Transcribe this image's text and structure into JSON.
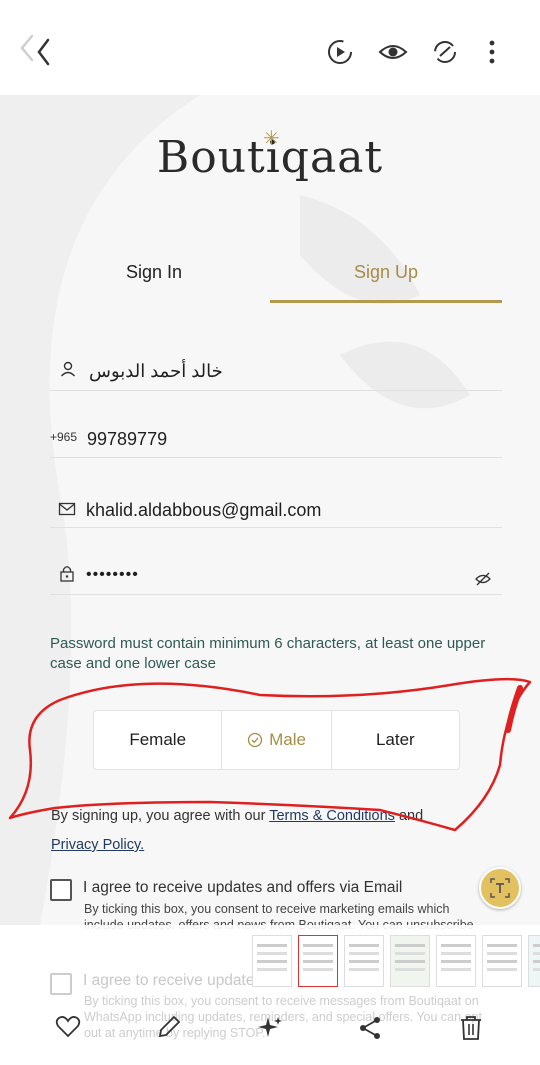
{
  "viewer": {
    "toolbar": {
      "back_icon": "chevron-left-icon",
      "actions": [
        "play-icon",
        "eye-icon",
        "rotate-icon",
        "more-vertical-icon"
      ]
    },
    "bottom_bar": {
      "actions": [
        "heart-icon",
        "pencil-icon",
        "sparkle-icon",
        "share-icon",
        "trash-icon"
      ]
    },
    "text_extract_badge": "text-scan-icon"
  },
  "app": {
    "logo_text": "Boutiqaat",
    "tabs": {
      "signin": "Sign In",
      "signup": "Sign Up"
    },
    "form": {
      "name_value": "خالد أحمد الدبوس",
      "phone_prefix": "+965",
      "phone_value": "99789779",
      "email_value": "khalid.aldabbous@gmail.com",
      "password_value": "••••••••",
      "password_hint": "Password must contain minimum 6 characters, at least one upper case and one lower case"
    },
    "gender": {
      "female": "Female",
      "male": "Male",
      "later": "Later",
      "selected": "Male"
    },
    "agreement": {
      "prefix": "By signing up, you agree with our",
      "terms_link": "Terms & Conditions",
      "and": "and",
      "privacy_link": "Privacy Policy."
    },
    "email_opt": {
      "title": "I agree to receive updates and offers via Email",
      "desc": "By ticking this box, you consent to receive marketing emails which include updates, offers and news from Boutiqaat. You can unsubscribe anytime via the link in our emails."
    },
    "whatsapp_opt": {
      "title": "I agree to receive updates and offers via WhatsApp",
      "desc": "By ticking this box, you consent to receive messages from Boutiqaat on WhatsApp including updates, reminders, and special offers. You can opt out at anytime by replying STOP."
    }
  },
  "colors": {
    "accent_gold": "#b49a4e",
    "hint_green": "#2f5a52",
    "annotation_red": "#e02020",
    "link_navy": "#213a63"
  }
}
